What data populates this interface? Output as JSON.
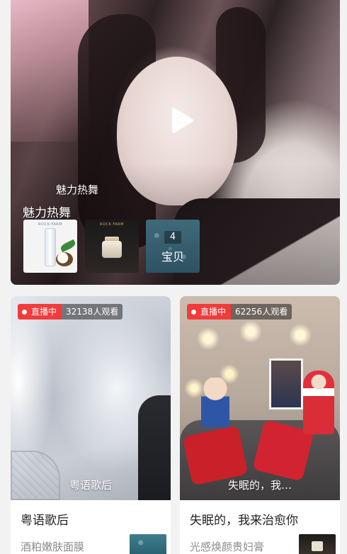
{
  "featured": {
    "subtitle": "魅力热舞",
    "title": "魅力热舞",
    "products": [
      {
        "brand": "ROCK·FARM"
      },
      {
        "brand": "ROCK·FARM"
      }
    ],
    "product_count": "4",
    "product_count_label": "宝贝",
    "icons": [
      "play-icon"
    ]
  },
  "streams": [
    {
      "status": "直播中",
      "viewers": "32138人观看",
      "caption": "粤语歌后",
      "title": "粤语歌后",
      "product": "酒粕嫩肤面膜"
    },
    {
      "status": "直播中",
      "viewers": "62256人观看",
      "caption": "失眠的，我…",
      "title": "失眠的，我来治愈你",
      "product": "光感焕颜贵妇膏"
    }
  ],
  "colors": {
    "live_badge": "#f23b3b",
    "background": "#f2f2f2"
  }
}
